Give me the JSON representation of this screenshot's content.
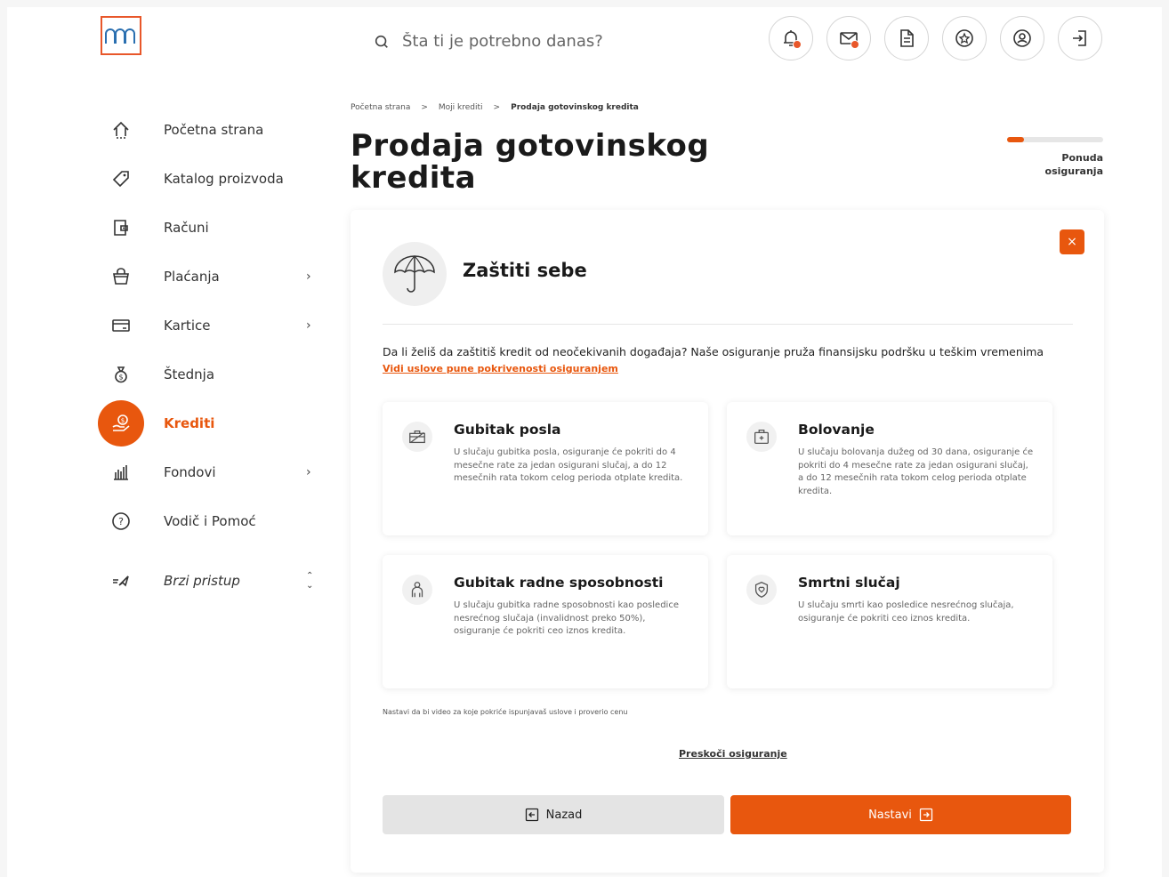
{
  "search": {
    "placeholder": "Šta ti je potrebno danas?"
  },
  "colors": {
    "accent": "#e8570e",
    "background": "#f6f6f6",
    "card": "#ffffff"
  },
  "top_icons": [
    "notifications-icon",
    "messages-icon",
    "documents-icon",
    "rewards-icon",
    "profile-icon",
    "logout-icon"
  ],
  "sidebar": {
    "items": [
      {
        "label": "Početna strana",
        "icon": "home-icon"
      },
      {
        "label": "Katalog proizvoda",
        "icon": "tag-icon"
      },
      {
        "label": "Računi",
        "icon": "wallet-icon"
      },
      {
        "label": "Plaćanja",
        "icon": "basket-icon",
        "chevron": "›"
      },
      {
        "label": "Kartice",
        "icon": "card-icon",
        "chevron": "›"
      },
      {
        "label": "Štednja",
        "icon": "money-bag-icon"
      },
      {
        "label": "Krediti",
        "icon": "loan-icon",
        "active": true
      },
      {
        "label": "Fondovi",
        "icon": "fund-chart-icon",
        "chevron": "›"
      },
      {
        "label": "Vodič i Pomoć",
        "icon": "help-icon"
      }
    ],
    "quick_access": {
      "label": "Brzi pristup",
      "icon": "quick-access-icon",
      "chevron": "⌃⌄"
    }
  },
  "breadcrumb": {
    "items": [
      "Početna strana",
      "Moji krediti",
      "Prodaja gotovinskog kredita"
    ],
    "separator": ">"
  },
  "page_title": "Prodaja gotovinskog kredita",
  "progress": {
    "label": "Ponuda osiguranja",
    "fraction": 0.18
  },
  "card": {
    "close_label": "×",
    "title": "Zaštiti sebe",
    "intro": "Da li želiš da zaštitiš kredit od neočekivanih događaja? Naše osiguranje pruža finansijsku podršku u teškim vremenima",
    "link": "Vidi uslove pune pokrivenosti osiguranjem",
    "tiles": [
      {
        "title": "Gubitak posla",
        "text": "U slučaju gubitka posla, osiguranje će pokriti do 4 mesečne rate za jedan osigurani slučaj, a do 12 mesečnih rata tokom celog perioda otplate kredita.",
        "icon": "briefcase-icon"
      },
      {
        "title": "Bolovanje",
        "text": "U slučaju bolovanja dužeg od 30 dana, osiguranje će pokriti do 4 mesečne rate za jedan osigurani slučaj, a do 12 mesečnih rata tokom celog perioda otplate kredita.",
        "icon": "medical-kit-icon"
      },
      {
        "title": "Gubitak radne sposobnosti",
        "text": "U slučaju gubitka radne sposobnosti kao posledice nesrećnog slučaja (invalidnost preko 50%), osiguranje će pokriti ceo iznos kredita.",
        "icon": "person-icon"
      },
      {
        "title": "Smrtni slučaj",
        "text": "U slučaju smrti kao posledice nesrećnog slučaja, osiguranje će pokriti ceo iznos kredita.",
        "icon": "shield-heart-icon"
      }
    ],
    "hint": "Nastavi da bi video za koje pokriće ispunjavaš uslove i proverio cenu",
    "skip": "Preskoči osiguranje",
    "back_label": "Nazad",
    "next_label": "Nastavi"
  }
}
